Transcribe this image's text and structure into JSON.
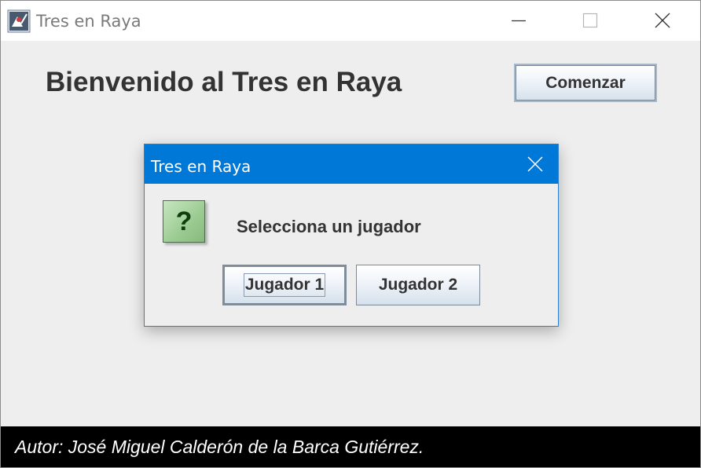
{
  "window": {
    "title": "Tres en Raya",
    "app_icon": "java-duke-icon",
    "controls": [
      "minimize-icon",
      "maximize-icon",
      "close-icon"
    ]
  },
  "main": {
    "heading": "Bienvenido al Tres en Raya",
    "start_button_label": "Comenzar"
  },
  "dialog": {
    "title": "Tres en Raya",
    "icon": "question-icon",
    "icon_glyph": "?",
    "message": "Selecciona un jugador",
    "buttons": {
      "player1_label": "Jugador 1",
      "player2_label": "Jugador 2"
    },
    "focused_button": "Jugador 1"
  },
  "footer": {
    "author_text": "Autor: José Miguel Calderón de la Barca Gutiérrez."
  },
  "colors": {
    "dialog_titlebar": "#0078d7",
    "window_background": "#eeeeee",
    "footer_background": "#000000",
    "question_icon_fill": "#9ccb92"
  }
}
